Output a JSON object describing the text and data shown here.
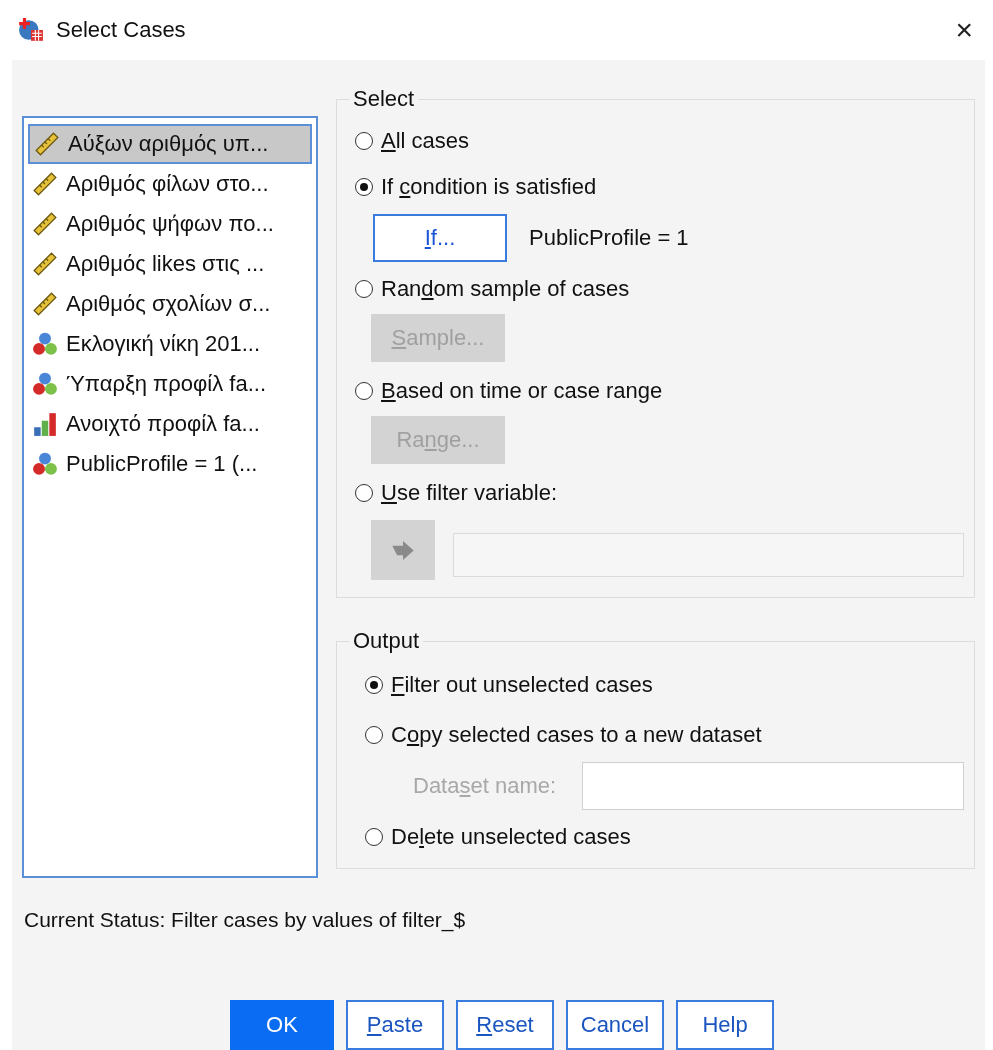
{
  "window": {
    "title": "Select Cases",
    "close": "×"
  },
  "variables": [
    {
      "kind": "scale",
      "name": "Αύξων αριθμός υπ...",
      "selected": true
    },
    {
      "kind": "scale",
      "name": "Αριθμός φίλων στο...",
      "selected": false
    },
    {
      "kind": "scale",
      "name": "Αριθμός ψήφων πο...",
      "selected": false
    },
    {
      "kind": "scale",
      "name": "Αριθμός likes στις ...",
      "selected": false
    },
    {
      "kind": "scale",
      "name": "Αριθμός σχολίων σ...",
      "selected": false
    },
    {
      "kind": "nominal",
      "name": "Εκλογική νίκη 201...",
      "selected": false
    },
    {
      "kind": "nominal",
      "name": "Ύπαρξη προφίλ fa...",
      "selected": false
    },
    {
      "kind": "ordinal",
      "name": "Ανοιχτό προφίλ fa...",
      "selected": false
    },
    {
      "kind": "nominal",
      "name": "PublicProfile = 1 (...",
      "selected": false
    }
  ],
  "select": {
    "title": "Select",
    "items": [
      {
        "kind": "radio",
        "selected": false,
        "label": {
          "key": "A",
          "post": "ll cases"
        }
      },
      {
        "kind": "radio",
        "selected": true,
        "label": {
          "pre": "If ",
          "key": "c",
          "post": "ondition is satisfied"
        }
      },
      {
        "kind": "if_row",
        "disabled": false,
        "focused": true,
        "label": {
          "key": "I",
          "post": "f..."
        },
        "condition": "PublicProfile = 1"
      },
      {
        "kind": "radio",
        "selected": false,
        "label": {
          "pre": "Ran",
          "key": "d",
          "post": "om sample of cases"
        }
      },
      {
        "kind": "button",
        "disabled": true,
        "label": {
          "key": "S",
          "post": "ample..."
        }
      },
      {
        "kind": "radio",
        "selected": false,
        "label": {
          "key": "B",
          "post": "ased on time or case range"
        }
      },
      {
        "kind": "button",
        "disabled": true,
        "label": {
          "pre": "Ra",
          "key": "n",
          "post": "ge..."
        }
      },
      {
        "kind": "radio",
        "selected": false,
        "label": {
          "key": "U",
          "post": "se filter variable:"
        }
      },
      {
        "kind": "filter_row",
        "disabled": true
      }
    ]
  },
  "output": {
    "title": "Output",
    "items": [
      {
        "kind": "radio",
        "selected": true,
        "label": {
          "key": "F",
          "post": "ilter out unselected cases"
        }
      },
      {
        "kind": "radio",
        "selected": false,
        "label": {
          "pre": "C",
          "key": "o",
          "post": "py selected cases to a new dataset"
        }
      },
      {
        "kind": "field",
        "disabled": true,
        "label": {
          "pre": "Data",
          "key": "s",
          "post": "et name:"
        }
      },
      {
        "kind": "radio",
        "selected": false,
        "label": {
          "pre": "De",
          "key": "l",
          "post": "ete unselected cases"
        }
      }
    ]
  },
  "status": "Current Status: Filter cases by values of filter_$",
  "buttons": [
    {
      "default": true,
      "label": {
        "pre": "OK"
      }
    },
    {
      "default": false,
      "label": {
        "key": "P",
        "post": "aste"
      }
    },
    {
      "default": false,
      "label": {
        "key": "R",
        "post": "eset"
      }
    },
    {
      "default": false,
      "label": {
        "pre": "Cancel"
      }
    },
    {
      "default": false,
      "label": {
        "pre": "Help"
      }
    }
  ]
}
